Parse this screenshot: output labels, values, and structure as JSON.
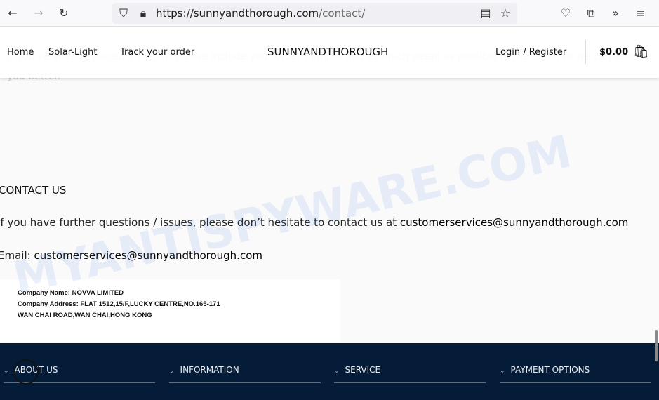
{
  "browser": {
    "url_host": "https://sunnyandthorough.com",
    "url_path": "/contact/"
  },
  "header": {
    "nav": [
      "Home",
      "Solar-Light",
      "Track your order"
    ],
    "logo": "SUNNYANDTHOROUGH",
    "login": "Login / Register",
    "cart": "$0.00"
  },
  "behind_text": "If you've already placed an order, please include your order number and as much detail as possible in the email so we can assist you better.",
  "contact": {
    "heading": "CONTACT US",
    "line1": "If you have further questions / issues, please don’t hesitate to contact us at ",
    "email1": "customerservices@sunnyandthorough.com",
    "line2": "Email: ",
    "email2": "customerservices@sunnyandthorough.com"
  },
  "company": {
    "name": "Company Name: NOVVA LIMITED",
    "address1": "Company Address: FLAT 1512,15/F,LUCKY CENTRE,NO.165-171",
    "address2": "WAN CHAI ROAD,WAN CHAI,HONG KONG"
  },
  "footer": {
    "columns": [
      "ABOUT US",
      "INFORMATION",
      "SERVICE",
      "PAYMENT OPTIONS"
    ]
  },
  "watermark": "MYANTISPYWARE.COM"
}
